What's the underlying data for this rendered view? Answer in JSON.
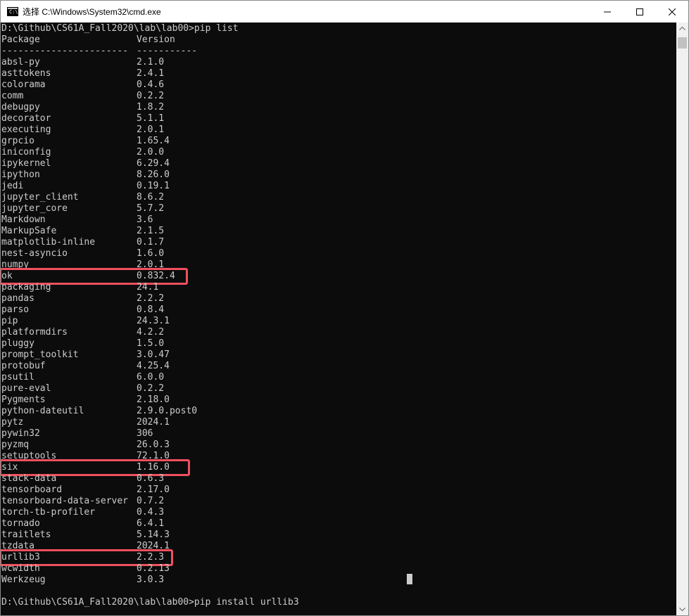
{
  "window": {
    "title": "选择 C:\\Windows\\System32\\cmd.exe",
    "app_icon": "cmd-icon",
    "app_icon_text": "C:\\",
    "controls": [
      "minimize-icon",
      "maximize-icon",
      "close-icon"
    ]
  },
  "console": {
    "command_line": "D:\\Github\\CS61A_Fall2020\\lab\\lab00>pip list",
    "header": {
      "package": "Package",
      "version": "Version"
    },
    "separator": {
      "package": "-----------------------",
      "version": "-----------"
    },
    "packages": [
      {
        "name": "absl-py",
        "version": "2.1.0"
      },
      {
        "name": "asttokens",
        "version": "2.4.1"
      },
      {
        "name": "colorama",
        "version": "0.4.6"
      },
      {
        "name": "comm",
        "version": "0.2.2"
      },
      {
        "name": "debugpy",
        "version": "1.8.2"
      },
      {
        "name": "decorator",
        "version": "5.1.1"
      },
      {
        "name": "executing",
        "version": "2.0.1"
      },
      {
        "name": "grpcio",
        "version": "1.65.4"
      },
      {
        "name": "iniconfig",
        "version": "2.0.0"
      },
      {
        "name": "ipykernel",
        "version": "6.29.4"
      },
      {
        "name": "ipython",
        "version": "8.26.0"
      },
      {
        "name": "jedi",
        "version": "0.19.1"
      },
      {
        "name": "jupyter_client",
        "version": "8.6.2"
      },
      {
        "name": "jupyter_core",
        "version": "5.7.2"
      },
      {
        "name": "Markdown",
        "version": "3.6"
      },
      {
        "name": "MarkupSafe",
        "version": "2.1.5"
      },
      {
        "name": "matplotlib-inline",
        "version": "0.1.7"
      },
      {
        "name": "nest-asyncio",
        "version": "1.6.0"
      },
      {
        "name": "numpy",
        "version": "2.0.1"
      },
      {
        "name": "ok",
        "version": "0.832.4",
        "highlighted": true
      },
      {
        "name": "packaging",
        "version": "24.1"
      },
      {
        "name": "pandas",
        "version": "2.2.2"
      },
      {
        "name": "parso",
        "version": "0.8.4"
      },
      {
        "name": "pip",
        "version": "24.3.1"
      },
      {
        "name": "platformdirs",
        "version": "4.2.2"
      },
      {
        "name": "pluggy",
        "version": "1.5.0"
      },
      {
        "name": "prompt_toolkit",
        "version": "3.0.47"
      },
      {
        "name": "protobuf",
        "version": "4.25.4"
      },
      {
        "name": "psutil",
        "version": "6.0.0"
      },
      {
        "name": "pure-eval",
        "version": "0.2.2"
      },
      {
        "name": "Pygments",
        "version": "2.18.0"
      },
      {
        "name": "python-dateutil",
        "version": "2.9.0.post0"
      },
      {
        "name": "pytz",
        "version": "2024.1"
      },
      {
        "name": "pywin32",
        "version": "306"
      },
      {
        "name": "pyzmq",
        "version": "26.0.3"
      },
      {
        "name": "setuptools",
        "version": "72.1.0"
      },
      {
        "name": "six",
        "version": "1.16.0",
        "highlighted": true
      },
      {
        "name": "stack-data",
        "version": "0.6.3"
      },
      {
        "name": "tensorboard",
        "version": "2.17.0"
      },
      {
        "name": "tensorboard-data-server",
        "version": "0.7.2"
      },
      {
        "name": "torch-tb-profiler",
        "version": "0.4.3"
      },
      {
        "name": "tornado",
        "version": "6.4.1"
      },
      {
        "name": "traitlets",
        "version": "5.14.3"
      },
      {
        "name": "tzdata",
        "version": "2024.1"
      },
      {
        "name": "urllib3",
        "version": "2.2.3",
        "highlighted": true
      },
      {
        "name": "wcwidth",
        "version": "0.2.13"
      },
      {
        "name": "Werkzeug",
        "version": "3.0.3"
      }
    ],
    "last_command": "D:\\Github\\CS61A_Fall2020\\lab\\lab00>pip install urllib3"
  },
  "colors": {
    "console_bg": "#0c0c0c",
    "console_fg": "#cccccc",
    "highlight_border": "#f0505e"
  }
}
